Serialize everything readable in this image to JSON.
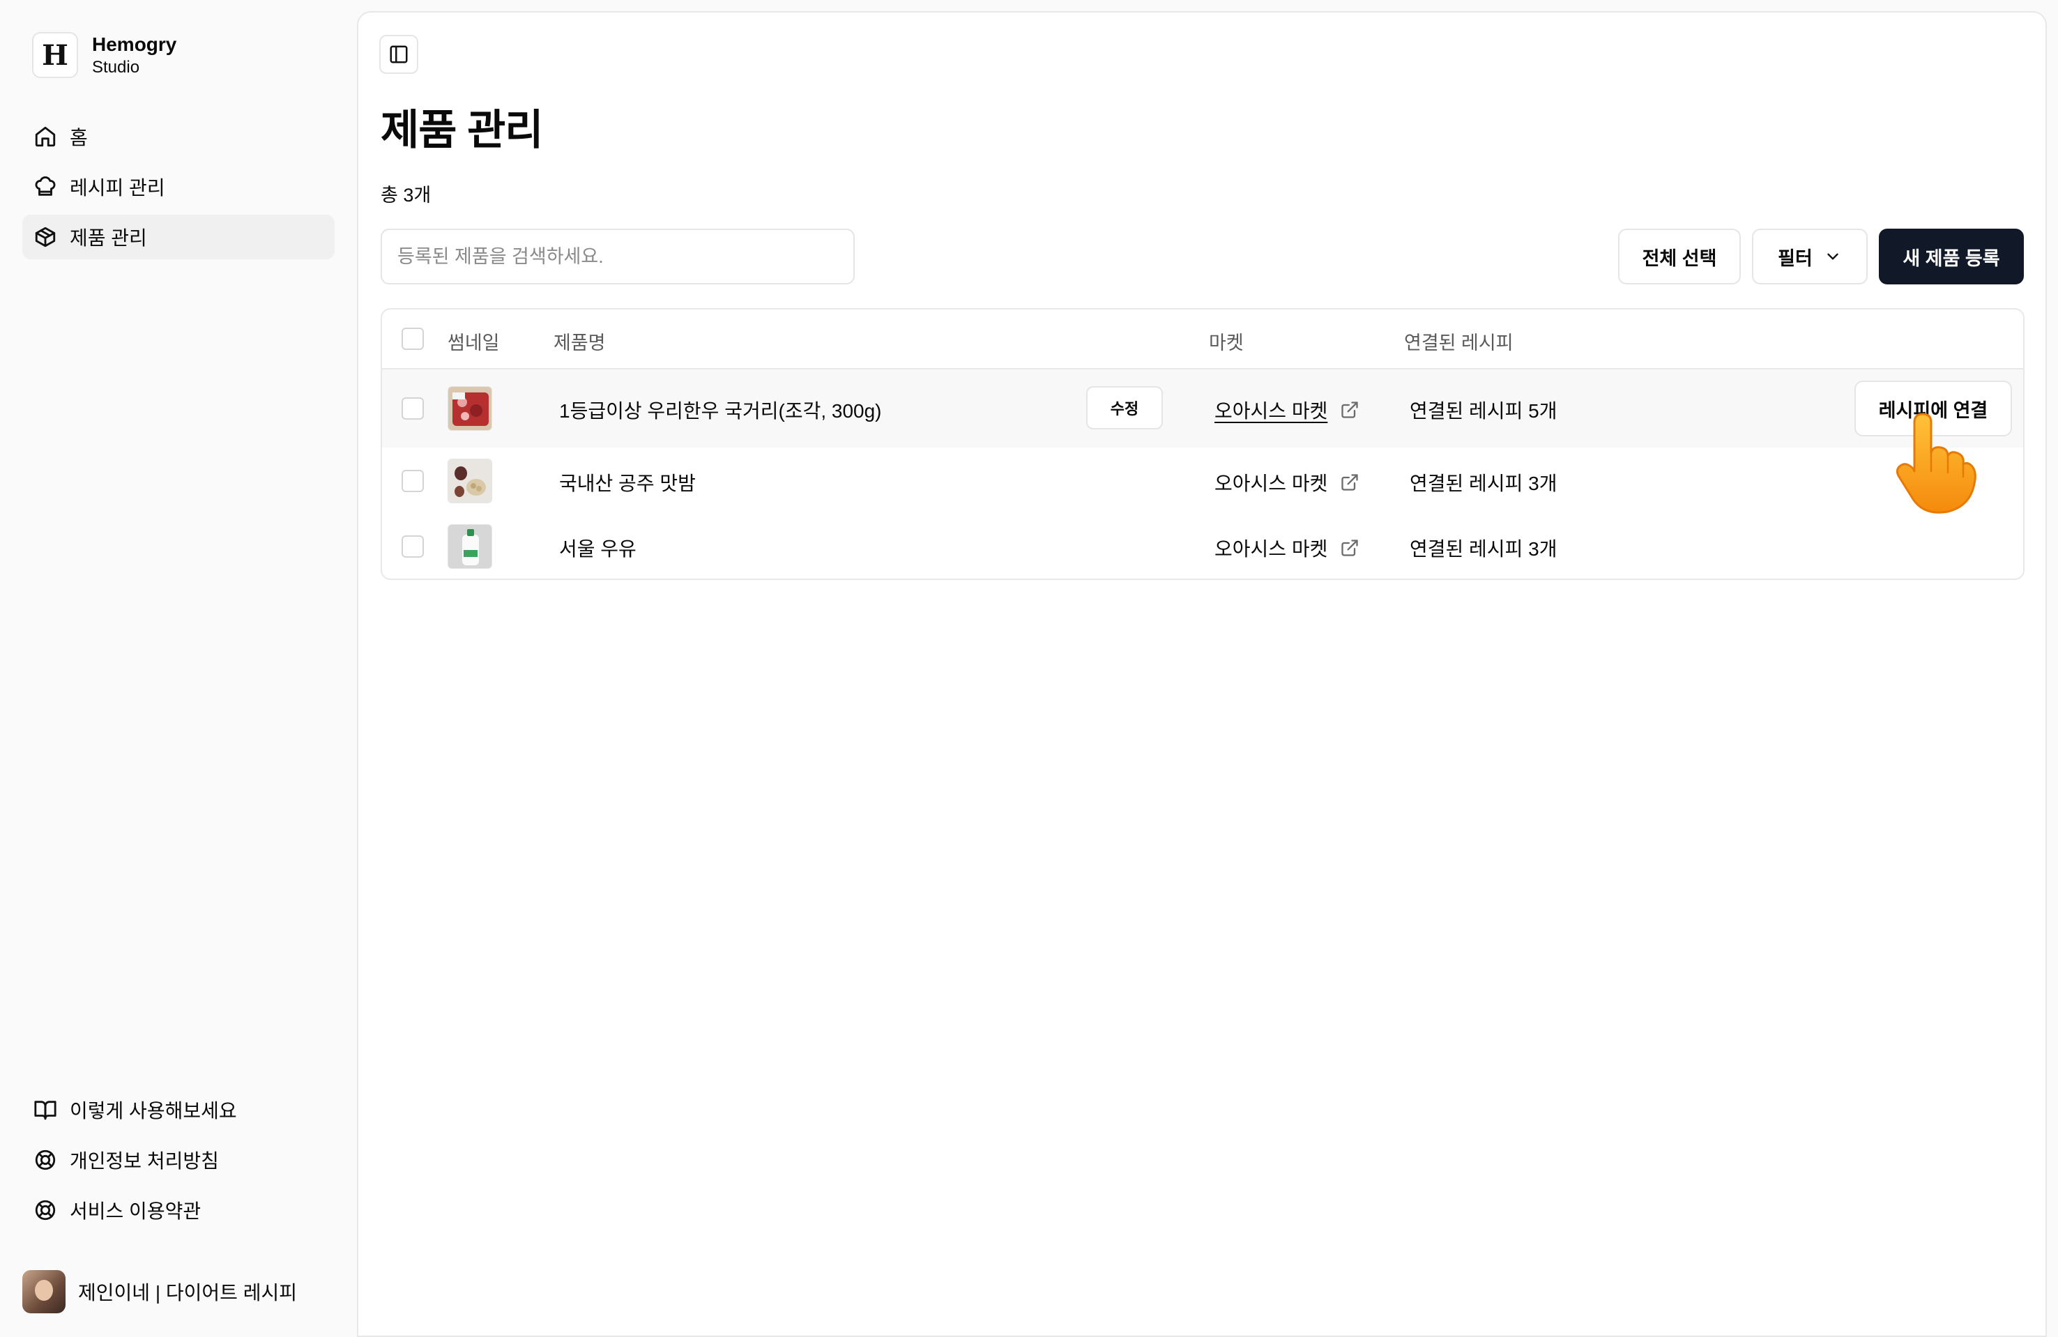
{
  "brand": {
    "name": "Hemogry",
    "sub": "Studio",
    "logo_letter": "H"
  },
  "sidebar": {
    "items": [
      {
        "label": "홈",
        "icon": "home-icon"
      },
      {
        "label": "레시피 관리",
        "icon": "chef-hat-icon"
      },
      {
        "label": "제품 관리",
        "icon": "package-icon",
        "active": true
      }
    ],
    "bottom_items": [
      {
        "label": "이렇게 사용해보세요",
        "icon": "book-open-icon"
      },
      {
        "label": "개인정보 처리방침",
        "icon": "lifebuoy-icon"
      },
      {
        "label": "서비스 이용약관",
        "icon": "lifebuoy-icon"
      }
    ],
    "user": {
      "name": "제인이네 | 다이어트 레시피"
    }
  },
  "main": {
    "title": "제품 관리",
    "total": "총 3개",
    "search_placeholder": "등록된 제품을 검색하세요.",
    "select_all": "전체 선택",
    "filter": "필터",
    "new_product": "새 제품 등록"
  },
  "table": {
    "headers": {
      "thumbnail": "썸네일",
      "name": "제품명",
      "market": "마켓",
      "linked": "연결된 레시피"
    },
    "rows": [
      {
        "name": "1등급이상 우리한우 국거리(조각, 300g)",
        "market": "오아시스 마켓",
        "linked": "연결된 레시피 5개",
        "edit": "수정",
        "link_action": "레시피에 연결",
        "thumb": "beef"
      },
      {
        "name": "국내산 공주 맛밤",
        "market": "오아시스 마켓",
        "linked": "연결된 레시피 3개",
        "thumb": "chestnut"
      },
      {
        "name": "서울 우유",
        "market": "오아시스 마켓",
        "linked": "연결된 레시피 3개",
        "thumb": "milk"
      }
    ]
  },
  "colors": {
    "primary_button": "#111827",
    "border": "#e5e5e5",
    "sidebar_bg": "#fafafa",
    "cursor": "#ff9f1c"
  }
}
